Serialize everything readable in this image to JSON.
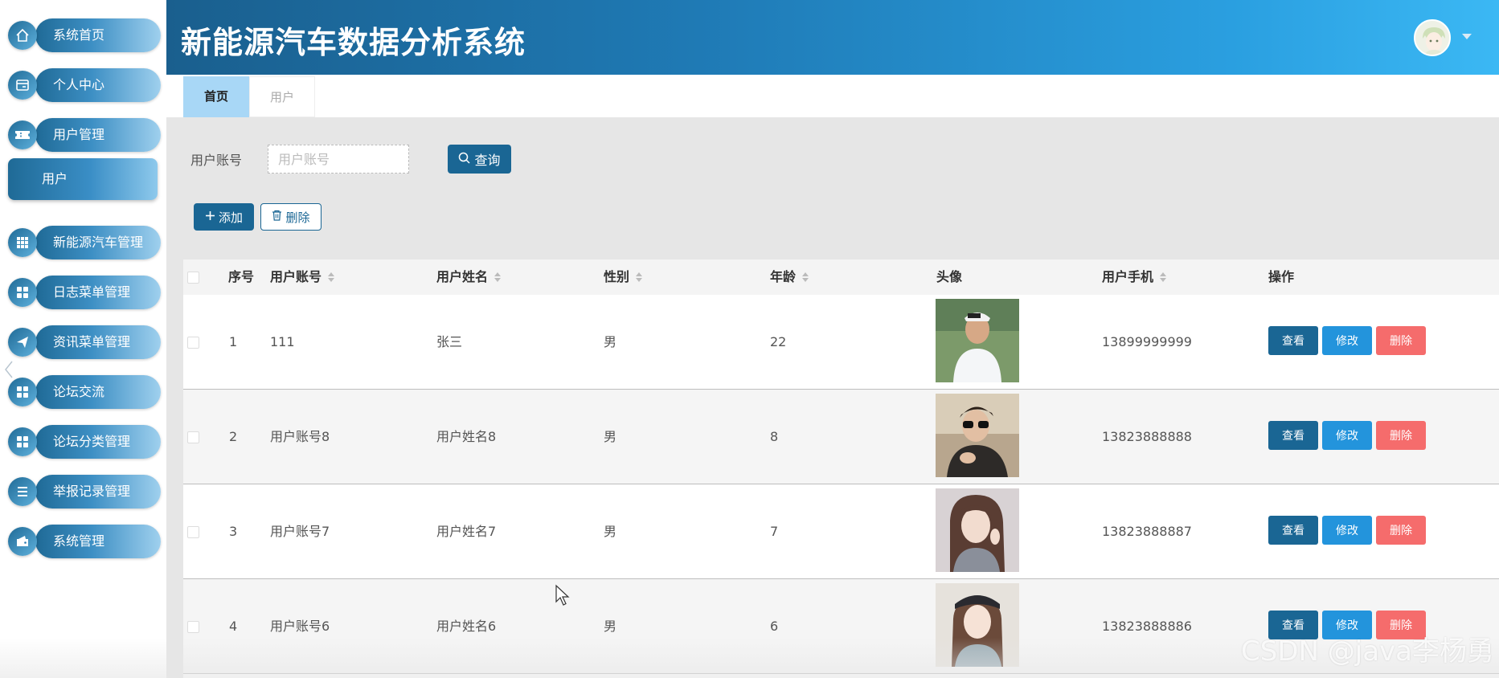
{
  "header": {
    "title": "新能源汽车数据分析系统"
  },
  "sidebar": {
    "items": [
      {
        "label": "系统首页",
        "icon": "home-icon"
      },
      {
        "label": "个人中心",
        "icon": "profile-card-icon"
      },
      {
        "label": "用户管理",
        "icon": "ticket-icon"
      },
      {
        "label": "新能源汽车管理",
        "icon": "grid-icon"
      },
      {
        "label": "日志菜单管理",
        "icon": "tiles-icon"
      },
      {
        "label": "资讯菜单管理",
        "icon": "send-icon"
      },
      {
        "label": "论坛交流",
        "icon": "tiles-icon"
      },
      {
        "label": "论坛分类管理",
        "icon": "tiles-icon"
      },
      {
        "label": "举报记录管理",
        "icon": "list-icon"
      },
      {
        "label": "系统管理",
        "icon": "wallet-icon"
      }
    ],
    "active_sub": "用户"
  },
  "tabs": [
    {
      "label": "首页",
      "active": true
    },
    {
      "label": "用户",
      "active": false
    }
  ],
  "search": {
    "label": "用户账号",
    "placeholder": "用户账号",
    "button": "查询"
  },
  "actions": {
    "add": "添加",
    "delete": "删除"
  },
  "table": {
    "columns": [
      "序号",
      "用户账号",
      "用户姓名",
      "性别",
      "年龄",
      "头像",
      "用户手机",
      "操作"
    ],
    "rows": [
      {
        "index": "1",
        "account": "111",
        "name": "张三",
        "gender": "男",
        "age": "22",
        "phone": "13899999999"
      },
      {
        "index": "2",
        "account": "用户账号8",
        "name": "用户姓名8",
        "gender": "男",
        "age": "8",
        "phone": "13823888888"
      },
      {
        "index": "3",
        "account": "用户账号7",
        "name": "用户姓名7",
        "gender": "男",
        "age": "7",
        "phone": "13823888887"
      },
      {
        "index": "4",
        "account": "用户账号6",
        "name": "用户姓名6",
        "gender": "男",
        "age": "6",
        "phone": "13823888886"
      }
    ],
    "row_actions": {
      "view": "查看",
      "edit": "修改",
      "delete": "删除"
    }
  },
  "watermark": "CSDN @java李杨勇",
  "colors": {
    "primary": "#1a6694",
    "edit": "#2394dc",
    "danger": "#f56c6c",
    "tab_active": "#a8d7f6"
  }
}
